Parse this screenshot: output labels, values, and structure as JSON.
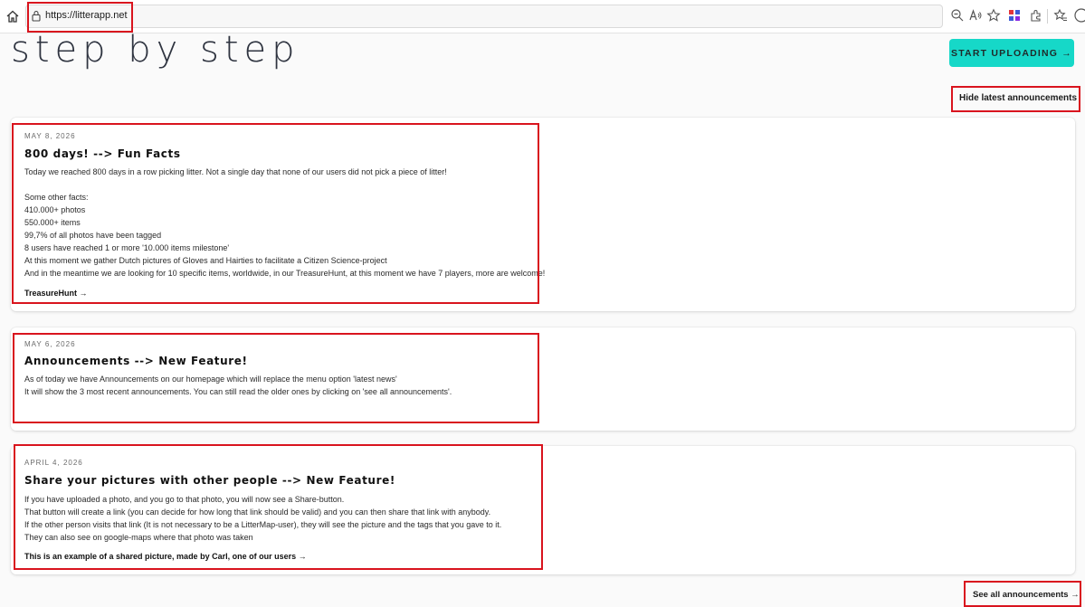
{
  "browser": {
    "url": "https://litterapp.net"
  },
  "page": {
    "headline": "step by step",
    "cta_label": "START UPLOADING →",
    "hide_announcements": "Hide latest announcements",
    "see_all": "See all announcements →"
  },
  "announcements": [
    {
      "date": "MAY 8, 2026",
      "title": "800 days! --> Fun Facts",
      "body": "Today we reached 800 days in a row picking litter. Not a single day that none of our users did not pick a piece of litter!\n\nSome other facts:\n410.000+ photos\n550.000+ items\n99,7% of all photos have been tagged\n8 users have reached 1 or more '10.000 items milestone'\nAt this moment we gather Dutch pictures of Gloves and Hairties to facilitate a Citizen Science-project\nAnd in the meantime we are looking for 10 specific items, worldwide, in our TreasureHunt, at this moment we have 7 players, more are welcome!",
      "link": "TreasureHunt →"
    },
    {
      "date": "MAY 6, 2026",
      "title": "Announcements --> New Feature!",
      "body": "As of today we have Announcements on our homepage which will replace the menu option 'latest news'\nIt will show the 3 most recent announcements. You can still read the older ones by clicking on 'see all announcements'."
    },
    {
      "date": "APRIL 4, 2026",
      "title": "Share your pictures with other people --> New Feature!",
      "body": "If you have uploaded a photo, and you go to that photo, you will now see a Share-button.\nThat button will create a link (you can decide for how long that link should be valid) and you can then share that link with anybody.\nIf the other person visits that link (It is not necessary to be a LitterMap-user), they will see the picture and the tags that you gave to it.\nThey can also see on google-maps where that photo was taken",
      "link": "This is an example of a shared picture, made by Carl, one of our users →"
    }
  ]
}
